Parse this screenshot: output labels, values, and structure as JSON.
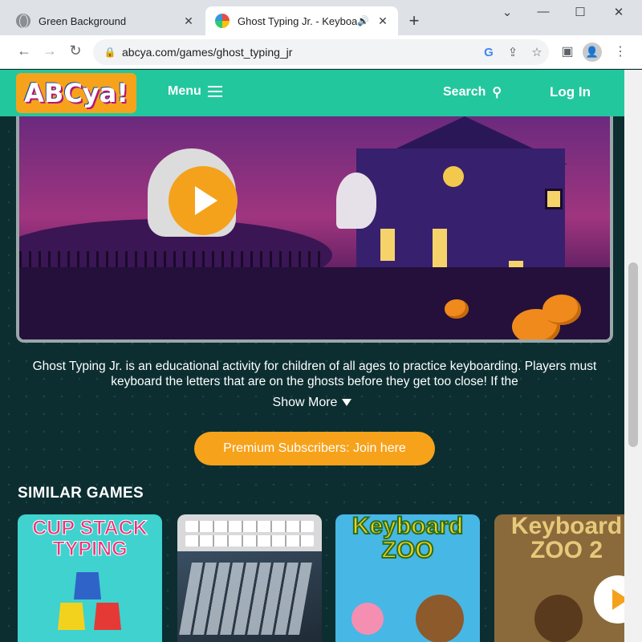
{
  "browser": {
    "tabs": [
      {
        "title": "Green Background",
        "close": "✕"
      },
      {
        "title": "Ghost Typing Jr. - Keyboardi",
        "close": "✕",
        "audio_icon": "speaker-icon"
      }
    ],
    "new_tab": "+",
    "window_controls": {
      "minimize": "—",
      "maximize": "☐",
      "close": "✕",
      "chevron": "⌄"
    },
    "url": "abcya.com/games/ghost_typing_jr"
  },
  "site": {
    "logo": "ABCya!",
    "menu_label": "Menu",
    "search_label": "Search",
    "login_label": "Log In",
    "accent_color": "#22c79e",
    "button_color": "#f7a21b"
  },
  "game": {
    "description": "Ghost Typing Jr. is an educational activity for children of all ages to practice keyboarding. Players must keyboard the letters that are on the ghosts before they get too close! If the",
    "show_more": "Show More",
    "premium_button": "Premium Subscribers: Join here"
  },
  "similar": {
    "heading": "SIMILAR GAMES",
    "cards": [
      {
        "title": "CUP STACK TYPING"
      },
      {
        "title": "",
        "keys_top": "Z  Y  X  W  V  U  T"
      },
      {
        "title": "Keyboard ZOO"
      },
      {
        "title": "Keyboard ZOO 2"
      }
    ]
  }
}
